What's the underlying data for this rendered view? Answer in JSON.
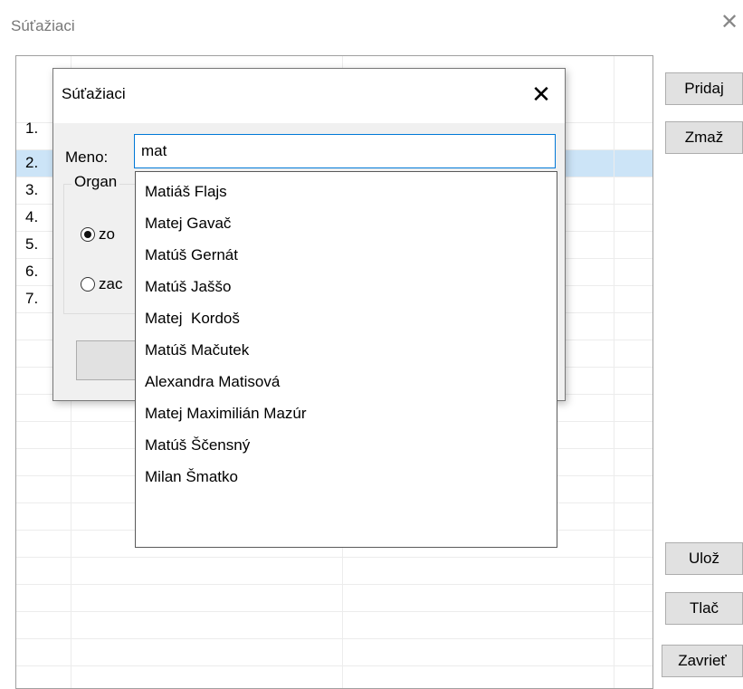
{
  "window": {
    "title": "Súťažiaci",
    "close_glyph": "✕"
  },
  "grid": {
    "row_numbers": [
      "1.",
      "2.",
      "3.",
      "4.",
      "5.",
      "6.",
      "7."
    ]
  },
  "side_buttons": {
    "add": "Pridaj",
    "delete": "Zmaž",
    "save": "Ulož",
    "print": "Tlač",
    "close": "Zavrieť"
  },
  "dialog": {
    "title": "Súťažiaci",
    "close_glyph": "✕",
    "name_label": "Meno:",
    "name_value": "mat",
    "group_label": "Organ",
    "radio1_label": "zo",
    "radio2_label": "zac"
  },
  "autocomplete": {
    "items": [
      "Matiáš Flajs",
      "Matej Gavač",
      "Matúš Gernát",
      "Matúš Jaššo",
      "Matej  Kordoš",
      "Matúš Mačutek",
      "Alexandra Matisová",
      "Matej Maximilián Mazúr",
      "Matúš Ščensný",
      "Milan Šmatko"
    ]
  }
}
